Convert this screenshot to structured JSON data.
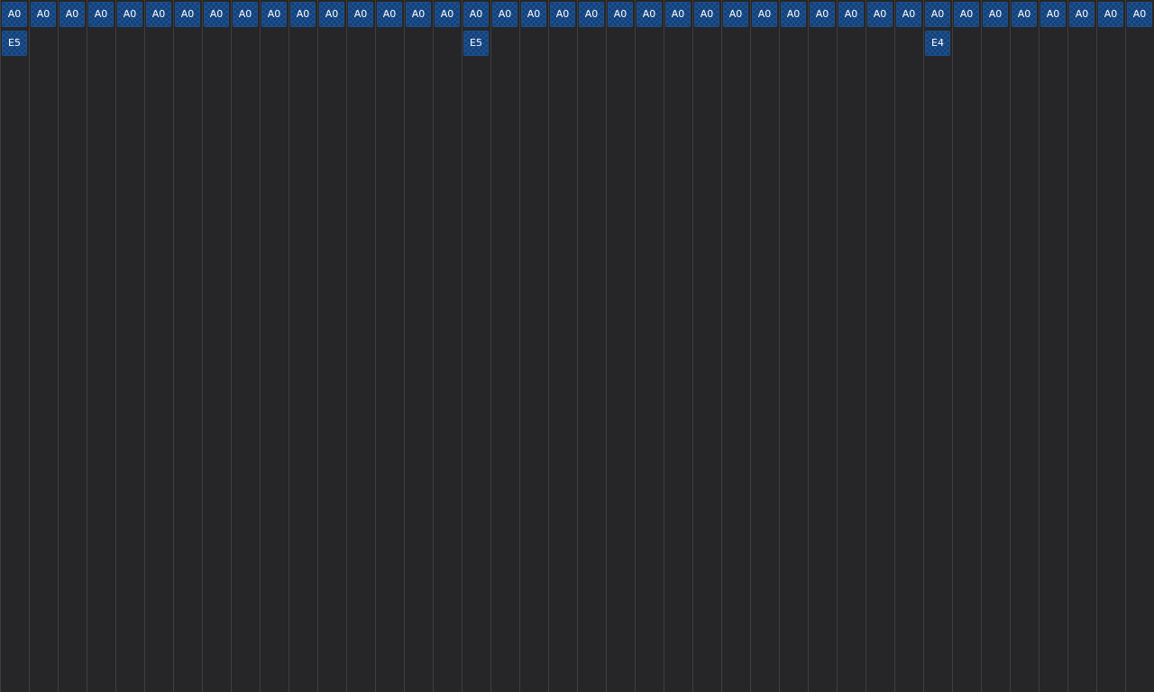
{
  "grid": {
    "top_row": [
      "A0",
      "A0",
      "A0",
      "A0",
      "A0",
      "A0",
      "A0",
      "A0",
      "A0",
      "A0",
      "A0",
      "A0",
      "A0",
      "A0",
      "A0",
      "A0",
      "A0",
      "A0",
      "A0",
      "A0",
      "A0",
      "A0",
      "A0",
      "A0",
      "A0",
      "A0",
      "A0",
      "A0",
      "A0",
      "A0",
      "A0",
      "A0",
      "A0",
      "A0",
      "A0",
      "A0",
      "A0",
      "A0",
      "A0",
      "A0"
    ],
    "second_row": [
      {
        "column": 1,
        "label": "E5"
      },
      {
        "column": 17,
        "label": "E5"
      },
      {
        "column": 33,
        "label": "E4"
      }
    ]
  },
  "colors": {
    "background": "#262628",
    "column_divider": "#3f3f42",
    "cell_fill": "#103f7a",
    "cell_border": "#1e4f86",
    "cell_text": "#ffffff"
  }
}
